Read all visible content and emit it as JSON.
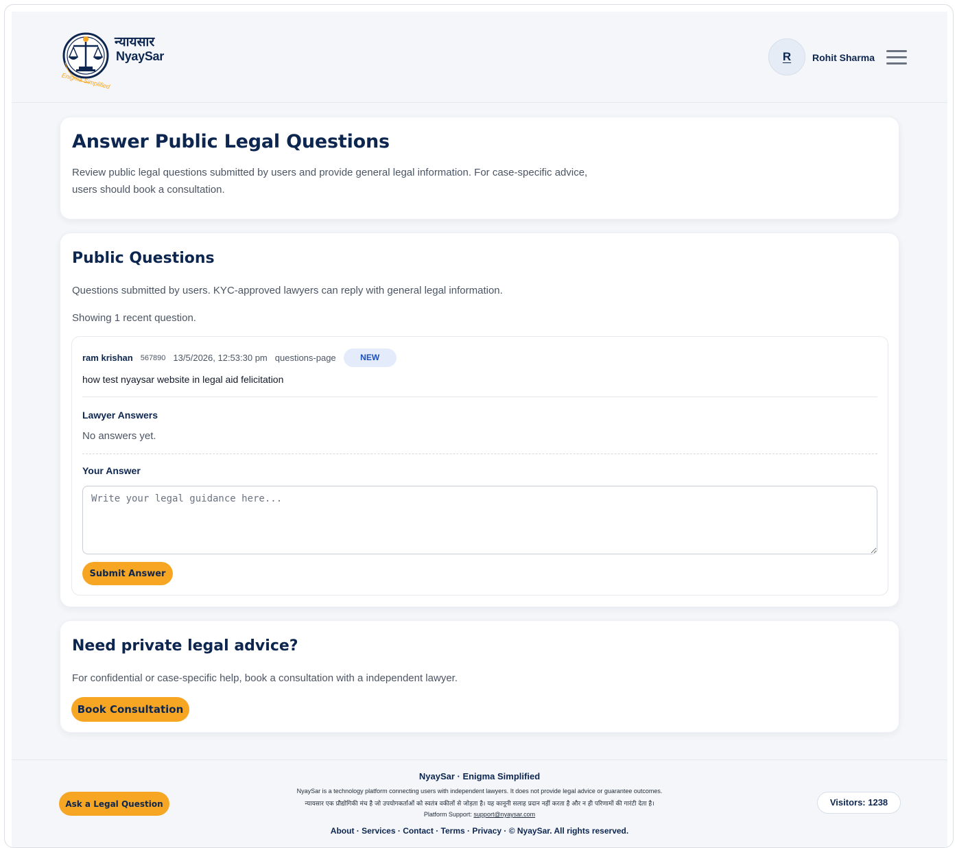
{
  "header": {
    "logo_hindi": "न्यायसार",
    "logo_en": "NyaySar",
    "logo_tagline": "Enigma Simplified",
    "avatar_initial": "R",
    "user_name": "Rohit Sharma",
    "menu_icon": "hamburger-icon"
  },
  "intro": {
    "title": "Answer Public Legal Questions",
    "description_line1": "Review public legal questions submitted by users and provide general legal information. For case-specific advice,",
    "description_line2": "users should book a consultation."
  },
  "questions": {
    "title": "Public Questions",
    "description": "Questions submitted by users. KYC-approved lawyers can reply with general legal information.",
    "count_text": "Showing 1 recent question.",
    "items": [
      {
        "author": "ram krishan",
        "id": "567890",
        "timestamp": "13/5/2026, 12:53:30 pm",
        "source": "questions-page",
        "status": "NEW",
        "text": "how test nyaysar website in legal aid felicitation",
        "answers_heading": "Lawyer Answers",
        "no_answers": "No answers yet.",
        "your_answer_heading": "Your Answer",
        "answer_placeholder": "Write your legal guidance here...",
        "submit_label": "Submit Answer"
      }
    ]
  },
  "private": {
    "title": "Need private legal advice?",
    "description": "For confidential or case-specific help, book a consultation with a independent lawyer.",
    "button_label": "Book Consultation"
  },
  "footer": {
    "ask_button": "Ask a Legal Question",
    "brand": "NyaySar · Enigma Simplified",
    "disclaimer_en": "NyaySar is a technology platform connecting users with independent lawyers. It does not provide legal advice or guarantee outcomes.",
    "disclaimer_hi": "न्यायसार एक प्रौद्योगिकी मंच है जो उपयोगकर्ताओं को स्वतंत्र वकीलों से जोड़ता है। यह कानूनी सलाह प्रदान नहीं करता है और न ही परिणामों की गारंटी देता है।",
    "support_label": "Platform Support:",
    "support_email": "support@nyaysar.com",
    "links": [
      "About",
      "Services",
      "Contact",
      "Terms",
      "Privacy"
    ],
    "separator": " · ",
    "copyright": "© NyaySar. All rights reserved.",
    "visitors": "Visitors: 1238"
  },
  "colors": {
    "navy": "#0d2650",
    "accent": "#f6a623",
    "badge_bg": "#e4ecfb",
    "badge_text": "#1d4fb8",
    "page_bg": "#f4f6f9"
  }
}
